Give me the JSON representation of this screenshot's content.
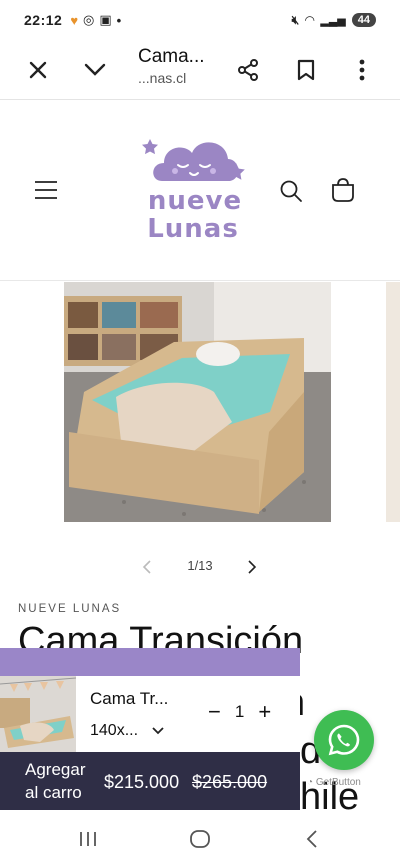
{
  "status_bar": {
    "time": "22:12",
    "icons": [
      "heart-icon",
      "whatsapp-icon",
      "screenshot-icon",
      "dot-icon"
    ],
    "right_icons": [
      "mute-icon",
      "wifi-icon",
      "signal-icon",
      "signal-icon"
    ],
    "battery": "44"
  },
  "browser": {
    "title": "Cama...",
    "domain": "...nas.cl",
    "icons": [
      "close-icon",
      "chevron-down-icon",
      "share-icon",
      "bookmark-icon",
      "more-icon"
    ]
  },
  "header": {
    "logo_line1": "nueve",
    "logo_line2": "Lunas",
    "logo_color": "#9b86c4",
    "icons": [
      "menu-icon",
      "search-icon",
      "cart-icon"
    ]
  },
  "gallery": {
    "counter": "1/13"
  },
  "product": {
    "vendor": "NUEVE LUNAS",
    "title": "Cama Transición"
  },
  "sticky": {
    "accent": "#9a86c8",
    "cta_bg": "#2f2e46",
    "name": "Cama Tr...",
    "variant": "140x...",
    "qty_minus": "−",
    "qty": "1",
    "qty_plus": "+",
    "cta_line1": "Agregar",
    "cta_line2": "al carro",
    "price": "$215.000",
    "old_price": "$265.000"
  },
  "whatsapp": {
    "color": "#3fbd53",
    "credit": "GetButton"
  },
  "behind": {
    "frag1": "n",
    "frag2": "do",
    "frag3": "hile"
  }
}
